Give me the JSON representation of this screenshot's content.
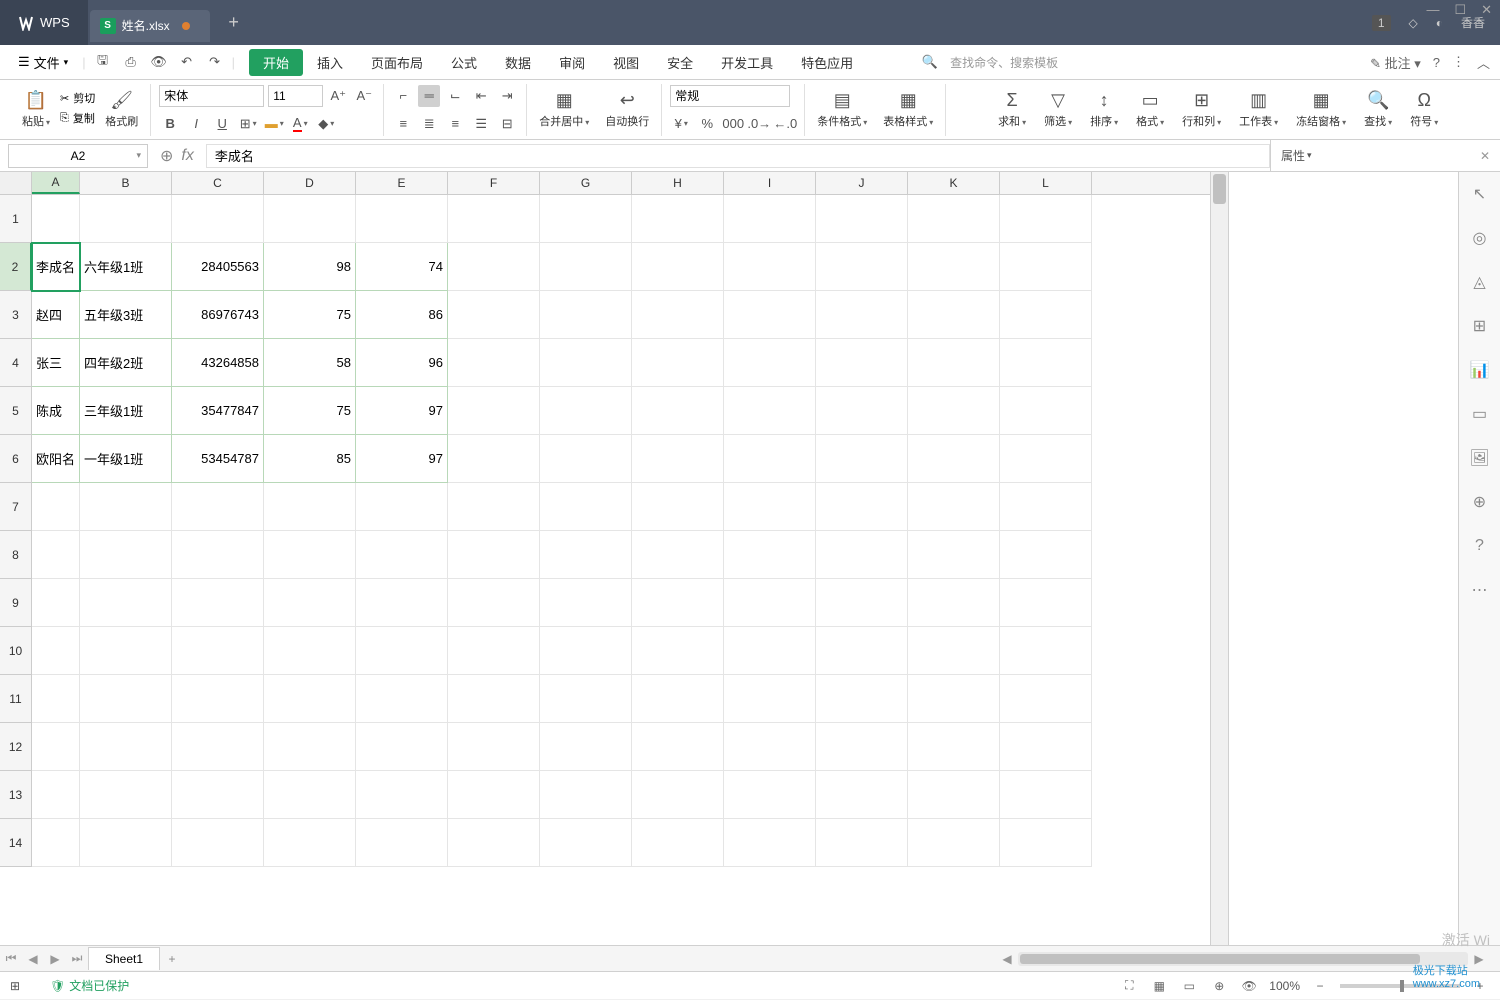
{
  "titlebar": {
    "app_name": "WPS",
    "file_name": "姓名.xlsx",
    "user_name": "香香",
    "badge": "1"
  },
  "window": {
    "min": "—",
    "max": "☐",
    "close": "✕"
  },
  "menu": {
    "file_btn": "文件",
    "tabs": [
      "开始",
      "插入",
      "页面布局",
      "公式",
      "数据",
      "审阅",
      "视图",
      "安全",
      "开发工具",
      "特色应用"
    ],
    "active_tab_index": 0,
    "search_placeholder": "查找命令、搜索模板",
    "annotate": "批注"
  },
  "ribbon": {
    "paste": "粘贴",
    "cut": "剪切",
    "copy": "复制",
    "format_painter": "格式刷",
    "font_name": "宋体",
    "font_size": "11",
    "merge_center": "合并居中",
    "auto_wrap": "自动换行",
    "number_format": "常规",
    "cond_format": "条件格式",
    "table_style": "表格样式",
    "sum": "求和",
    "filter": "筛选",
    "sort": "排序",
    "format": "格式",
    "row_col": "行和列",
    "worksheet": "工作表",
    "freeze": "冻结窗格",
    "find": "查找",
    "symbol": "符号"
  },
  "formula_bar": {
    "name_box": "A2",
    "formula_value": "李成名",
    "prop_label": "属性"
  },
  "columns": [
    "A",
    "B",
    "C",
    "D",
    "E",
    "F",
    "G",
    "H",
    "I",
    "J",
    "K",
    "L"
  ],
  "visible_rows": 14,
  "active_cell": {
    "row": 2,
    "col": "A"
  },
  "data_rows": [
    {
      "A": "李成名",
      "B": "六年级1班",
      "C": "28405563",
      "D": "98",
      "E": "74"
    },
    {
      "A": "赵四",
      "B": "五年级3班",
      "C": "86976743",
      "D": "75",
      "E": "86"
    },
    {
      "A": "张三",
      "B": "四年级2班",
      "C": "43264858",
      "D": "58",
      "E": "96"
    },
    {
      "A": "陈成",
      "B": "三年级1班",
      "C": "35477847",
      "D": "75",
      "E": "97"
    },
    {
      "A": "欧阳名",
      "B": "一年级1班",
      "C": "53454787",
      "D": "85",
      "E": "97"
    }
  ],
  "sheet_tabs": {
    "active": "Sheet1"
  },
  "statusbar": {
    "doc_protected": "文档已保护",
    "zoom": "100%"
  },
  "watermark": {
    "activate": "激活 Wi",
    "site1": "极光下载站",
    "site2": "www.xz7.com"
  }
}
